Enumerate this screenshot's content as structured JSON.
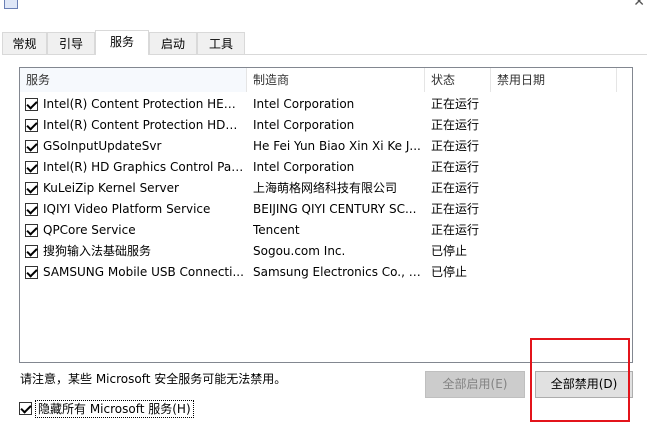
{
  "tabs": [
    "常规",
    "引导",
    "服务",
    "启动",
    "工具"
  ],
  "active_tab": "服务",
  "columns": {
    "service": "服务",
    "manufacturer": "制造商",
    "status": "状态",
    "disabled_date": "禁用日期"
  },
  "services": [
    {
      "name": "Intel(R) Content Protection HECI ...",
      "manufacturer": "Intel Corporation",
      "status": "正在运行",
      "disabled_date": "",
      "checked": true
    },
    {
      "name": "Intel(R) Content Protection HDCP...",
      "manufacturer": "Intel Corporation",
      "status": "正在运行",
      "disabled_date": "",
      "checked": true
    },
    {
      "name": "GSoInputUpdateSvr",
      "manufacturer": "He Fei Yun Biao Xin Xi Ke J...",
      "status": "正在运行",
      "disabled_date": "",
      "checked": true
    },
    {
      "name": "Intel(R) HD Graphics Control Pan...",
      "manufacturer": "Intel Corporation",
      "status": "正在运行",
      "disabled_date": "",
      "checked": true
    },
    {
      "name": "KuLeiZip Kernel Server",
      "manufacturer": "上海萌格网络科技有限公司",
      "status": "正在运行",
      "disabled_date": "",
      "checked": true
    },
    {
      "name": "IQIYI Video Platform Service",
      "manufacturer": "BEIJING QIYI CENTURY SC...",
      "status": "正在运行",
      "disabled_date": "",
      "checked": true
    },
    {
      "name": "QPCore Service",
      "manufacturer": "Tencent",
      "status": "正在运行",
      "disabled_date": "",
      "checked": true
    },
    {
      "name": "搜狗输入法基础服务",
      "manufacturer": "Sogou.com Inc.",
      "status": "已停止",
      "disabled_date": "",
      "checked": true
    },
    {
      "name": "SAMSUNG Mobile USB Connecti...",
      "manufacturer": "Samsung Electronics Co., L...",
      "status": "已停止",
      "disabled_date": "",
      "checked": true
    }
  ],
  "note": "请注意，某些 Microsoft 安全服务可能无法禁用。",
  "buttons": {
    "enable_all": "全部启用(E)",
    "disable_all": "全部禁用(D)"
  },
  "hide_ms_label": "隐藏所有 Microsoft 服务(H)",
  "hide_ms_checked": true,
  "colors": {
    "highlight": "#e3141b",
    "list_border": "#828790"
  }
}
